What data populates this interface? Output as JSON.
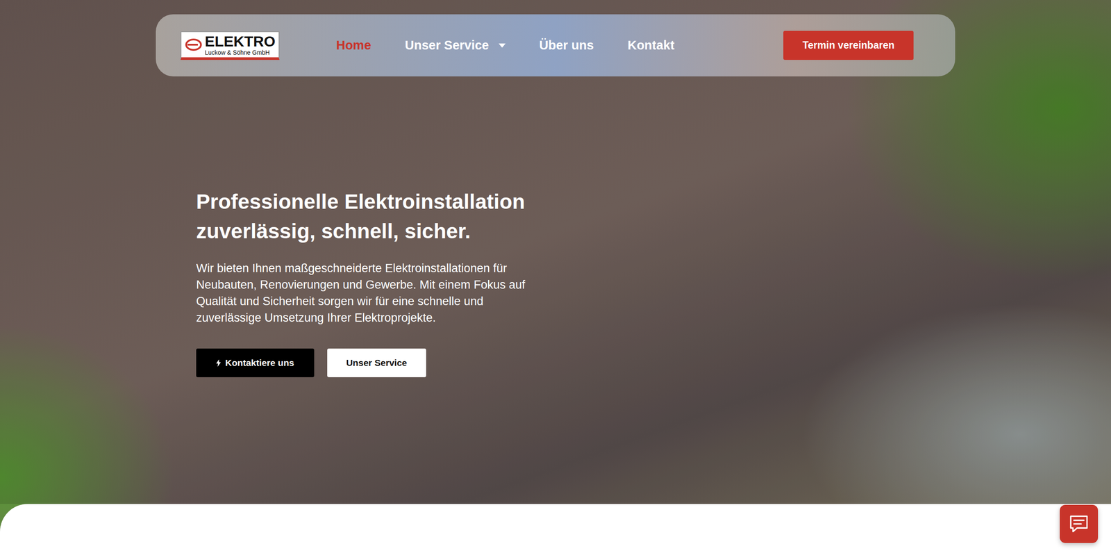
{
  "logo": {
    "title": "ELEKTRO",
    "subtitle": "Luckow & Söhne GmbH"
  },
  "nav": [
    {
      "label": "Home",
      "selected": true,
      "dropdown": false
    },
    {
      "label": "Unser Service",
      "selected": false,
      "dropdown": true
    },
    {
      "label": "Über uns",
      "selected": false,
      "dropdown": false
    },
    {
      "label": "Kontakt",
      "selected": false,
      "dropdown": false
    }
  ],
  "cta": "Termin vereinbaren",
  "hero": {
    "title_lines": [
      "Professionelle Elektroinstallation",
      "zuverlässig, schnell, sicher."
    ],
    "text": "Wir bieten Ihnen maßgeschneiderte Elektroinstallationen für Neubauten, Renovierungen und Gewerbe. Mit einem Fokus auf Qualität und Sicherheit sorgen wir für eine schnelle und zuverlässige Umsetzung Ihrer Elektroprojekte.",
    "buttons": [
      {
        "label": "Kontaktiere uns",
        "kind": "primary"
      },
      {
        "label": "Unser Service",
        "kind": "secondary"
      }
    ]
  }
}
